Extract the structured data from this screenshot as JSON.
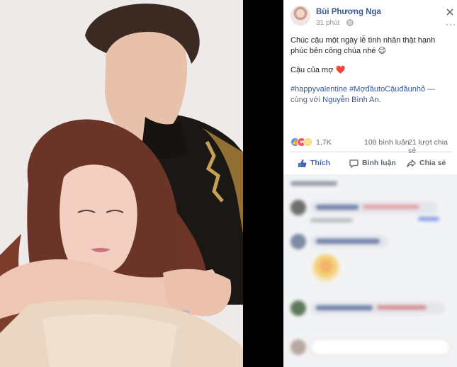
{
  "post": {
    "author": "Bùi Phương Nga",
    "time": "31 phút",
    "caption_line1": "Chúc cậu một ngày lễ tình nhân thật hạnh phúc bên công chúa nhé 😉",
    "caption_line2": "Cậu của mợ ❤️",
    "hashtag1": "#happyvalentine",
    "hashtag2": "#MợđầutoCậuđầunhỏ",
    "with_text": " — cùng với ",
    "tagged_person": "Nguyễn Bình An."
  },
  "stats": {
    "reactions": "1,7K",
    "comments": "108 bình luận",
    "shares": "21 lượt chia sẻ"
  },
  "actions": {
    "like": "Thích",
    "comment": "Bình luận",
    "share": "Chia sẻ"
  },
  "colors": {
    "link": "#385898",
    "like_active": "#4267b2",
    "reaction_like": "#5890ff",
    "reaction_love": "#f25268",
    "reaction_wow": "#fcd469"
  },
  "icons": [
    "globe-icon",
    "close-icon",
    "more-icon",
    "like-icon",
    "comment-icon",
    "share-icon"
  ]
}
